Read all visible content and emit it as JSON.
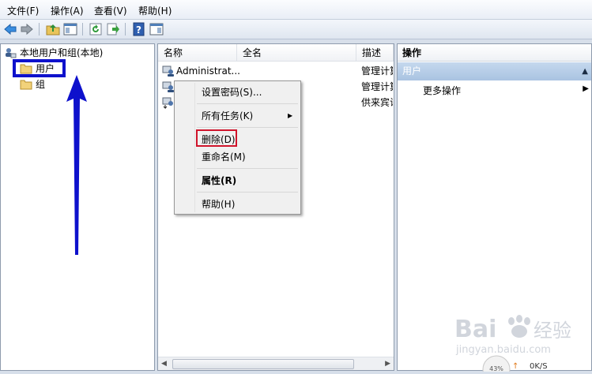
{
  "menubar": {
    "items": [
      "文件(F)",
      "操作(A)",
      "查看(V)",
      "帮助(H)"
    ]
  },
  "toolbar": {
    "icons": [
      "back-arrow-icon",
      "forward-arrow-icon",
      "up-folder-icon",
      "show-hide-tree-icon",
      "refresh-icon",
      "export-list-icon",
      "help-icon",
      "properties-icon"
    ]
  },
  "tree": {
    "root_label": "本地用户和组(本地)",
    "children": [
      "用户",
      "组"
    ]
  },
  "list": {
    "columns": [
      "名称",
      "全名",
      "描述"
    ],
    "rows": [
      {
        "name": "Administrat...",
        "desc": "管理计算"
      },
      {
        "name": "",
        "desc": "管理计算"
      },
      {
        "name": "",
        "desc": "供来宾访"
      }
    ]
  },
  "context_menu": {
    "items": [
      "设置密码(S)...",
      "所有任务(K)",
      "删除(D)",
      "重命名(M)",
      "属性(R)",
      "帮助(H)"
    ]
  },
  "actions": {
    "header": "操作",
    "section": "用户",
    "more": "更多操作"
  },
  "watermark": {
    "brand": "Bai",
    "cn": "经验",
    "url": "jingyan.baidu.com"
  },
  "net_widget": {
    "percent": "43%",
    "speed": "0K/S"
  },
  "colors": {
    "highlight_blue": "#0e11cc",
    "highlight_red": "#d0142b",
    "action_section": "#a9c3e1"
  }
}
